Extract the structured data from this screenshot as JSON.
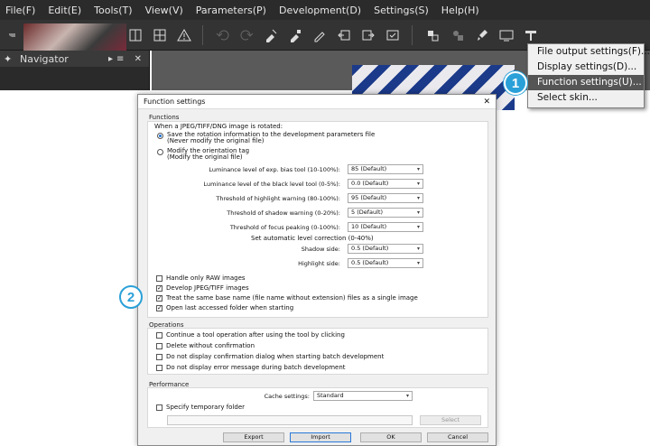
{
  "menubar": {
    "items": [
      "File(F)",
      "Edit(E)",
      "Tools(T)",
      "View(V)",
      "Parameters(P)",
      "Development(D)",
      "Settings(S)",
      "Help(H)"
    ]
  },
  "toolbar": {
    "icons": [
      "rotate-left-icon",
      "forward-icon",
      "grid-four-icon",
      "view-single-selected-icon",
      "view-blank-icon",
      "view-compare-icon",
      "view-quad-icon",
      "warning-icon",
      "undo-icon",
      "redo-icon",
      "develop-icon",
      "develop-selected-icon",
      "edit-icon",
      "open-left-icon",
      "open-right-icon",
      "check-box-icon",
      "puzzle-icon",
      "puzzle-alt-icon",
      "brush-icon",
      "monitor-icon",
      "ruler-icon"
    ]
  },
  "navigator": {
    "title": "Navigator",
    "controls": "▸≡ ✕"
  },
  "dropdown": {
    "items": [
      "File output settings(F)...",
      "Display settings(D)...",
      "Function settings(U)...",
      "Select skin..."
    ],
    "highlighted_index": 2
  },
  "callouts": [
    "1",
    "2"
  ],
  "dialog": {
    "title": "Function settings",
    "close": "✕",
    "functions": {
      "label": "Functions",
      "rotate_prompt": "When a JPEG/TIFF/DNG image is rotated:",
      "radio1_line1": "Save the rotation information to the development  parameters file",
      "radio1_line2": "(Never modify the original file)",
      "radio2_line1": "Modify the orientation tag",
      "radio2_line2": "(Modify the original file)",
      "settings": [
        {
          "label": "Luminance level of exp. bias tool (10-100%):",
          "value": "85 (Default)"
        },
        {
          "label": "Luminance level of the black level tool (0-5%):",
          "value": "0.0 (Default)"
        },
        {
          "label": "Threshold of highlight warning (80-100%):",
          "value": "95 (Default)"
        },
        {
          "label": "Threshold of shadow warning (0-20%):",
          "value": "5 (Default)"
        },
        {
          "label": "Threshold of focus peaking (0-100%):",
          "value": "10 (Default)"
        }
      ],
      "auto_level_label": "Set automatic level correction (0-40%)",
      "shadow_label": "Shadow side:",
      "shadow_value": "0.5 (Default)",
      "highlight_label": "Highlight side:",
      "highlight_value": "0.5 (Default)",
      "checks": [
        {
          "label": "Handle only RAW images",
          "checked": false
        },
        {
          "label": "Develop JPEG/TIFF images",
          "checked": true
        },
        {
          "label": "Treat the same base name (file name without extension) files as a single image",
          "checked": true
        },
        {
          "label": "Open last accessed folder when starting",
          "checked": true
        }
      ]
    },
    "operations": {
      "label": "Operations",
      "checks": [
        {
          "label": "Continue a tool operation after using the tool by clicking",
          "checked": false
        },
        {
          "label": "Delete without confirmation",
          "checked": false
        },
        {
          "label": "Do not display confirmation dialog when starting batch development",
          "checked": false
        },
        {
          "label": "Do not display error message during batch development",
          "checked": false
        }
      ]
    },
    "performance": {
      "label": "Performance",
      "cache_label": "Cache settings:",
      "cache_value": "Standard",
      "temp_label": "Specify temporary folder",
      "select_button": "Select"
    },
    "buttons": {
      "export": "Export",
      "import": "Import",
      "ok": "OK",
      "cancel": "Cancel"
    }
  },
  "colors": {
    "callout": "#2aa0d8",
    "menu_bg": "#2b2b2b",
    "highlight": "#555555"
  }
}
